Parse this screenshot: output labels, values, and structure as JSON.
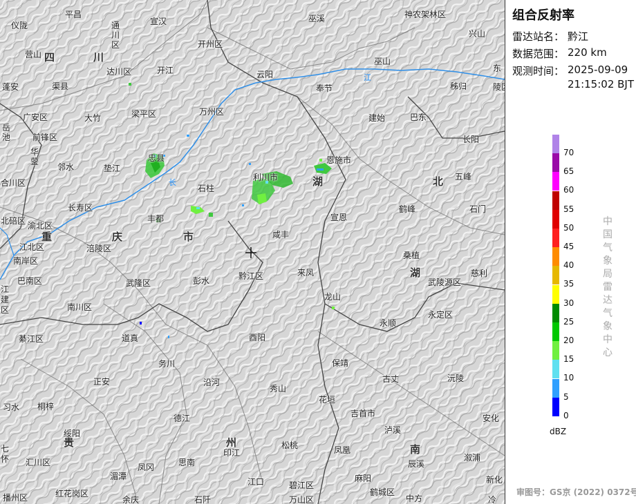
{
  "title": "组合反射率",
  "info": [
    {
      "label": "雷达站名：",
      "value": "黔江"
    },
    {
      "label": "数据范围：",
      "value": "220 km"
    },
    {
      "label": "观测时间：",
      "value": "2025-09-09"
    }
  ],
  "time_line2": "21:15:02 BJT",
  "legend": {
    "unit": "dBZ",
    "levels": [
      {
        "value": "70",
        "color": "#b083e8"
      },
      {
        "value": "65",
        "color": "#9a0aa8"
      },
      {
        "value": "60",
        "color": "#ff00ff"
      },
      {
        "value": "55",
        "color": "#c00000"
      },
      {
        "value": "50",
        "color": "#e00000"
      },
      {
        "value": "45",
        "color": "#ff2020"
      },
      {
        "value": "40",
        "color": "#ff8c00"
      },
      {
        "value": "35",
        "color": "#e6b800"
      },
      {
        "value": "30",
        "color": "#ffff00"
      },
      {
        "value": "25",
        "color": "#008c00"
      },
      {
        "value": "20",
        "color": "#00c800"
      },
      {
        "value": "15",
        "color": "#70f040"
      },
      {
        "value": "10",
        "color": "#60e0f0"
      },
      {
        "value": "5",
        "color": "#30a0ff"
      },
      {
        "value": "0",
        "color": "#0000ff"
      }
    ]
  },
  "agency_vertical": "中国气象局雷达气象中心",
  "credit": "审图号：GS京 (2022) 0372号",
  "river_label": "江",
  "river_label2": "长",
  "provinces": [
    "四",
    "川",
    "重",
    "庆",
    "市",
    "湖",
    "北",
    "湖",
    "南",
    "贵",
    "州"
  ],
  "places": [
    "平昌",
    "宣汉",
    "巫溪",
    "神农架林区",
    "仪陇",
    "通川区",
    "开州区",
    "兴山",
    "营山",
    "达川区",
    "开江",
    "巫山",
    "东",
    "渠县",
    "云阳",
    "奉节",
    "秭归",
    "蓬安",
    "陵区",
    "大竹",
    "梁平区",
    "万州区",
    "建始",
    "巴东",
    "广安区",
    "岳池",
    "前锋区",
    "忠县",
    "恩施市",
    "长阳",
    "华蓥",
    "邻水",
    "垫江",
    "利川市",
    "五峰",
    "合川区",
    "石柱",
    "长寿区",
    "丰都",
    "宣恩",
    "鹤峰",
    "石门",
    "北碚区",
    "渝北区",
    "咸丰",
    "江北区",
    "涪陵区",
    "桑植",
    "慈利",
    "南岸区",
    "巴南区",
    "武隆区",
    "彭水",
    "黔江区",
    "来凤",
    "武陵源区",
    "江",
    "建",
    "区",
    "龙山",
    "南川区",
    "永定区",
    "道真",
    "永顺",
    "綦江区",
    "酉阳",
    "务川",
    "保靖",
    "正安",
    "沿河",
    "秀山",
    "古丈",
    "沅陵",
    "习水",
    "桐梓",
    "花垣",
    "吉首市",
    "德江",
    "泸溪",
    "安化",
    "绥阳",
    "七",
    "怀",
    "印江",
    "松桃",
    "凤凰",
    "汇川区",
    "思南",
    "辰溪",
    "溆浦",
    "湄潭",
    "凤冈",
    "江口",
    "麻阳",
    "新化",
    "播州区",
    "红花岗区",
    "余庆",
    "石阡",
    "碧江区",
    "万山区",
    "鹤城区",
    "中方",
    "冷"
  ]
}
